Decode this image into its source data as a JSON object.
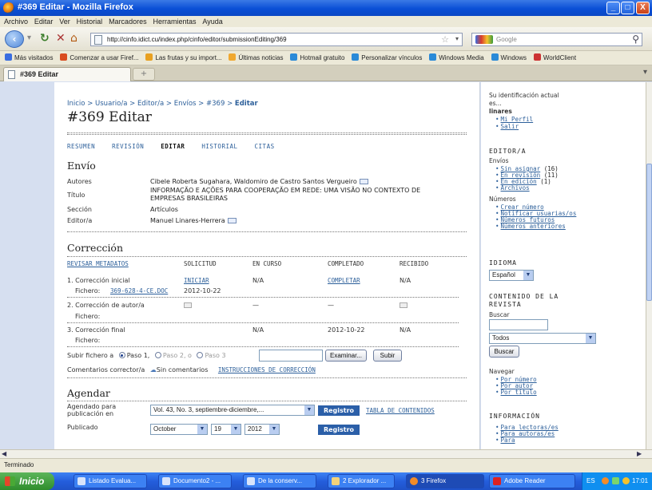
{
  "window": {
    "title": "#369 Editar - Mozilla Firefox",
    "controls": [
      "_",
      "□",
      "X"
    ]
  },
  "menu": [
    "Archivo",
    "Editar",
    "Ver",
    "Historial",
    "Marcadores",
    "Herramientas",
    "Ayuda"
  ],
  "nav": {
    "url": "http://cinfo.idict.cu/index.php/cinfo/editor/submissionEditing/369",
    "search_placeholder": "Google"
  },
  "bookmarks": [
    {
      "label": "Más visitados",
      "color": "#3a6ee0"
    },
    {
      "label": "Comenzar a usar Firef...",
      "color": "#d94b1f"
    },
    {
      "label": "Las frutas y su import...",
      "color": "#e8a020"
    },
    {
      "label": "Últimas noticias",
      "color": "#f0a830"
    },
    {
      "label": "Hotmail gratuito",
      "color": "#2a8ad8"
    },
    {
      "label": "Personalizar vínculos",
      "color": "#2a8ad8"
    },
    {
      "label": "Windows Media",
      "color": "#2a8ad8"
    },
    {
      "label": "Windows",
      "color": "#2a8ad8"
    },
    {
      "label": "WorldClient",
      "color": "#cc3333"
    }
  ],
  "tab": {
    "label": "#369 Editar",
    "new_tab": "+"
  },
  "page": {
    "breadcrumb": {
      "items": [
        "Inicio",
        "Usuario/a",
        "Editor/a",
        "Envíos",
        "#369"
      ],
      "current": "Editar",
      "sep": " > "
    },
    "title": "#369 Editar",
    "subnav": [
      "RESUMEN",
      "REVISIÓN",
      "EDITAR",
      "HISTORIAL",
      "CITAS"
    ],
    "envio": {
      "heading": "Envío",
      "autores_label": "Autores",
      "autores": "Cibele Roberta Sugahara, Waldomiro de Castro Santos Vergueiro",
      "titulo_label": "Título",
      "titulo_l1": "INFORMAÇÃO E AÇÕES PARA COOPERAÇÃO EM REDE: UMA VISÃO NO CONTEXTO DE",
      "titulo_l2": "EMPRESAS BRASILEIRAS",
      "seccion_label": "Sección",
      "seccion": "Artículos",
      "editor_label": "Editor/a",
      "editor": "Manuel Linares-Herrera"
    },
    "correccion": {
      "heading": "Corrección",
      "revisar": "REVISAR METADATOS",
      "cols": [
        "SOLICITUD",
        "EN CURSO",
        "COMPLETADO",
        "RECIBIDO"
      ],
      "r1_label": "1. Corrección inicial",
      "r1_solicitud": "INICIAR",
      "r1_encurso": "N/A",
      "r1_completado": "COMPLETAR",
      "r1_recibido": "N/A",
      "fichero_label": "Fichero:",
      "r1_file": "369-628-4-CE.DOC",
      "r1_file_date": "2012-10-22",
      "r2_label": "2. Corrección de autor/a",
      "r2_encurso": "—",
      "r2_completado": "—",
      "r3_label": "3. Corrección final",
      "r3_encurso": "N/A",
      "r3_completado": "2012-10-22",
      "r3_recibido": "N/A",
      "subir_label": "Subir fichero a",
      "paso1": "Paso 1,",
      "paso2": "Paso 2, o",
      "paso3": "Paso 3",
      "examinar": "Examinar...",
      "subir": "Subir",
      "comentarios_label": "Comentarios corrector/a",
      "sin_comentarios": "Sin comentarios",
      "instrucciones": "INSTRUCCIONES DE CORRECCIÓN"
    },
    "agendar": {
      "heading": "Agendar",
      "agendado_label_l1": "Agendado para",
      "agendado_label_l2": "publicación en",
      "issue": "Vol. 43, No. 3, septiembre-diciembre,...",
      "registro": "Registro",
      "tabla": "TABLA DE CONTENIDOS",
      "publicado_label": "Publicado",
      "month": "October",
      "day": "19",
      "year": "2012"
    }
  },
  "sidebar": {
    "ident_l1": "Su identificación actual",
    "ident_l2": "es...",
    "user": "linares",
    "user_links": [
      "Mi Perfil",
      "Salir"
    ],
    "editor_heading": "EDITOR/A",
    "envios_label": "Envíos",
    "envios": [
      {
        "link": "Sin asignar",
        "count": "(16)"
      },
      {
        "link": "En revisión",
        "count": "(11)"
      },
      {
        "link": "En edición",
        "count": "(1)"
      },
      {
        "link": "Archivos",
        "count": ""
      }
    ],
    "numeros_label": "Números",
    "numeros": [
      "Crear número",
      "Notificar usuarias/os",
      "Números futuros",
      "Números anteriores"
    ],
    "idioma_heading": "IDIOMA",
    "idioma_value": "Español",
    "contenido_heading_l1": "CONTENIDO DE LA",
    "contenido_heading_l2": "REVISTA",
    "buscar_label": "Buscar",
    "buscar_scope": "Todos",
    "buscar_btn": "Buscar",
    "navegar_label": "Navegar",
    "navegar": [
      "Por número",
      "Por autor",
      "Por título"
    ],
    "info_heading": "INFORMACIÓN",
    "info": [
      "Para lectoras/es",
      "Para autoras/es",
      "Para"
    ]
  },
  "status": "Terminado",
  "taskbar": {
    "start": "Inicio",
    "tasks": [
      "Listado Evalua...",
      "Documento2 - ...",
      "De la conserv...",
      "2 Explorador ...",
      "3 Firefox",
      "Adobe Reader"
    ],
    "lang": "ES",
    "clock": "17:01"
  }
}
